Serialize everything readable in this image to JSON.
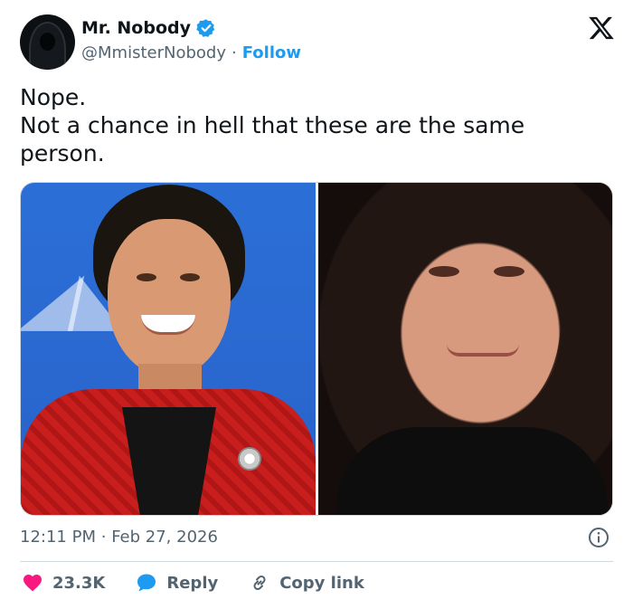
{
  "author": {
    "display_name": "Mr. Nobody",
    "handle": "@MmisterNobody",
    "separator": "·",
    "follow_label": "Follow"
  },
  "tweet": {
    "lines": [
      "Nope.",
      "Not a chance in hell that these are the same",
      "person."
    ]
  },
  "footer": {
    "time": "12:11 PM",
    "separator": "·",
    "date": "Feb 27, 2026"
  },
  "actions": {
    "likes": "23.3K",
    "reply_label": "Reply",
    "copy_label": "Copy link"
  },
  "colors": {
    "accent": "#1d9bf0",
    "like": "#f91880",
    "text_secondary": "#536471",
    "divider": "#cfd9de"
  },
  "icons": {
    "verified": "verified-badge-icon",
    "brand": "x-logo-icon",
    "info": "info-icon",
    "like": "heart-icon",
    "reply": "speech-bubble-icon",
    "copy": "link-icon"
  }
}
